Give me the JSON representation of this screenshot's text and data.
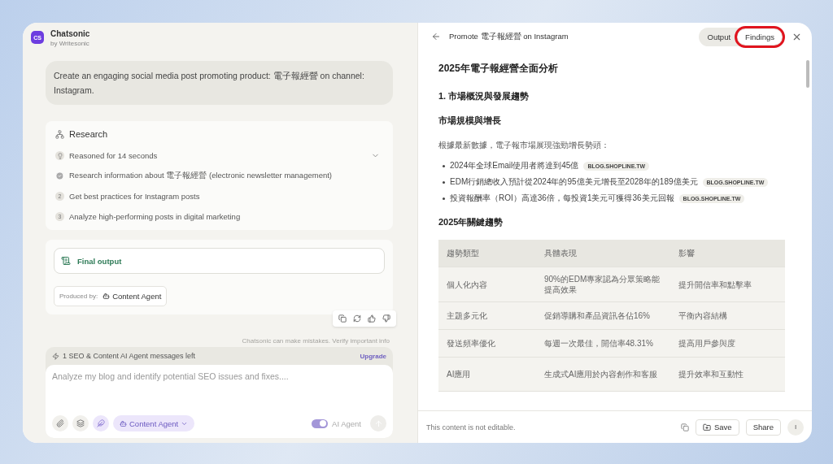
{
  "app": {
    "name": "Chatsonic",
    "byline": "by Writesonic",
    "logo": "CS"
  },
  "user_message": "Create an engaging social media post promoting product: 電子報經營 on channel: Instagram.",
  "research": {
    "title": "Research",
    "expanded": false,
    "steps": [
      {
        "kind": "reasoning",
        "text": "Reasoned for 14 seconds"
      },
      {
        "kind": "done",
        "text": "Research information about 電子報經營 (electronic newsletter management)"
      },
      {
        "kind": "number",
        "marker": "2",
        "text": "Get best practices for Instagram posts"
      },
      {
        "kind": "number",
        "marker": "3",
        "text": "Analyze high-performing posts in digital marketing"
      }
    ]
  },
  "output_card": {
    "final_output": "Final output",
    "produced_by_label": "Produced by:",
    "agent": "Content Agent"
  },
  "disclaimer": "Chatsonic can make mistakes. Verify important info",
  "composer": {
    "quota": "1 SEO & Content AI Agent messages left",
    "upgrade": "Upgrade",
    "placeholder": "Analyze my blog and identify potential SEO issues and fixes....",
    "agent": "Content Agent",
    "ai_agent_label": "AI Agent",
    "ai_agent_on": true
  },
  "panel": {
    "title": "Promote 電子報經營 on Instagram",
    "tabs": [
      {
        "label": "Output",
        "selected": false,
        "annotated": false
      },
      {
        "label": "Findings",
        "selected": true,
        "annotated": true
      }
    ]
  },
  "document": {
    "title": "2025年電子報經營全面分析",
    "section": "1. 市場概況與發展趨勢",
    "subsection": "市場規模與增長",
    "intro": "根據最新數據，電子報市場展現強勁增長勢頭：",
    "bullets": [
      {
        "text": "2024年全球Email使用者將達到45億",
        "source": "BLOG.SHOPLINE.TW"
      },
      {
        "text": "EDM行銷總收入預計從2024年的95億美元增長至2028年的189億美元",
        "source": "BLOG.SHOPLINE.TW"
      },
      {
        "text": "投資報酬率（ROI）高達36倍，每投資1美元可獲得36美元回報",
        "source": "BLOG.SHOPLINE.TW"
      }
    ],
    "table_heading": "2025年關鍵趨勢",
    "table": {
      "columns": [
        "趨勢類型",
        "具體表現",
        "影響"
      ],
      "rows": [
        [
          "個人化內容",
          "90%的EDM專家認為分眾策略能提高效果",
          "提升開信率和點擊率"
        ],
        [
          "主題多元化",
          "促銷導購和產品資訊各佔16%",
          "平衡內容結構"
        ],
        [
          "發送頻率優化",
          "每週一次最佳，開信率48.31%",
          "提高用戶參與度"
        ],
        [
          "AI應用",
          "生成式AI應用於內容創作和客服",
          "提升效率和互動性"
        ]
      ]
    }
  },
  "footer": {
    "note": "This content is not editable.",
    "save": "Save",
    "share": "Share",
    "avatar": "I"
  }
}
